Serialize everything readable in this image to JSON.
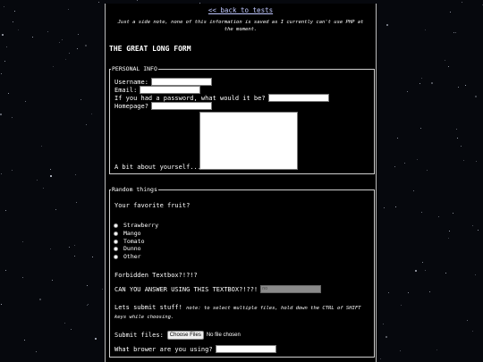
{
  "nav": {
    "back_link": "<< back to tests"
  },
  "note": "Just a side note, none of this information is saved as I currently can't use PHP at the moment.",
  "page_title": "THE GREAT LONG FORM",
  "personal_info": {
    "legend": "PERSONAL INFO",
    "username_label": "Username:",
    "email_label": "Email:",
    "password_label": "If you had a password, what would it be?",
    "homepage_label": "Homepage?",
    "about_label": "A bit about yourself..."
  },
  "random_things": {
    "legend": "Random things",
    "fruit_question": "Your favorite fruit?",
    "fruits": [
      "Strawberry",
      "Mango",
      "Tomato",
      "Dunno",
      "Other"
    ],
    "forbidden_label": "Forbidden Textbox?!?!?",
    "answer_label": "CAN YOU ANSWER USING THIS TEXTBOX?!??!",
    "answer_value": "no",
    "submit_stuff_label": "Lets submit stuff!",
    "submit_note": "note: to select multiple files, hold down the CTRL of SHIFT keys while choosing.",
    "submit_files_label": "Submit files:",
    "choose_files_button": "Choose Files",
    "no_file_text": "No file chosen",
    "browser_label": "What brower are you using?"
  },
  "colors": {
    "page_bg": "#000000",
    "link": "#bfc7ff",
    "background": "#05070c"
  }
}
